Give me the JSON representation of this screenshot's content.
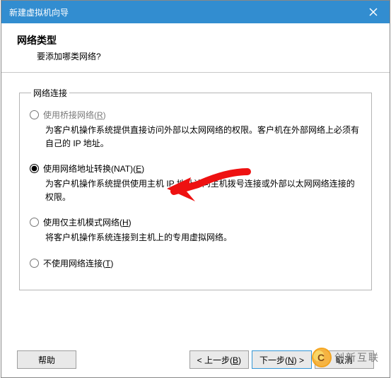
{
  "titlebar": {
    "title": "新建虚拟机向导"
  },
  "header": {
    "heading": "网络类型",
    "sub": "要添加哪类网络?"
  },
  "group": {
    "legend": "网络连接",
    "options": [
      {
        "id": "bridge",
        "label_pre": "使用桥接网络(",
        "mnemonic": "R",
        "label_post": ")",
        "desc": "为客户机操作系统提供直接访问外部以太网网络的权限。客户机在外部网络上必须有自己的 IP 地址。",
        "disabled": true,
        "checked": false
      },
      {
        "id": "nat",
        "label_pre": "使用网络地址转换(NAT)(",
        "mnemonic": "E",
        "label_post": ")",
        "desc": "为客户机操作系统提供使用主机 IP 地址访问主机拨号连接或外部以太网网络连接的权限。",
        "disabled": false,
        "checked": true
      },
      {
        "id": "hostonly",
        "label_pre": "使用仅主机模式网络(",
        "mnemonic": "H",
        "label_post": ")",
        "desc": "将客户机操作系统连接到主机上的专用虚拟网络。",
        "disabled": false,
        "checked": false
      },
      {
        "id": "none",
        "label_pre": "不使用网络连接(",
        "mnemonic": "T",
        "label_post": ")",
        "desc": "",
        "disabled": false,
        "checked": false
      }
    ]
  },
  "buttons": {
    "help": "帮助",
    "back_pre": "< 上一步(",
    "back_m": "B",
    "back_post": ")",
    "next_pre": "下一步(",
    "next_m": "N",
    "next_post": ") >",
    "cancel": "取消"
  },
  "watermark": "创新互联"
}
